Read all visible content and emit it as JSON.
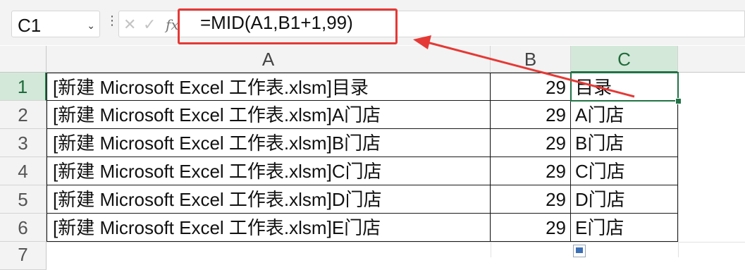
{
  "name_box": {
    "value": "C1"
  },
  "formula_bar": {
    "formula": "=MID(A1,B1+1,99)",
    "fx_label": "fx",
    "cancel_icon": "✕",
    "enter_icon": "✓"
  },
  "columns": [
    "A",
    "B",
    "C"
  ],
  "selected_cell": "C1",
  "rows": [
    {
      "num": "1",
      "a": "[新建 Microsoft Excel 工作表.xlsm]目录",
      "b": "29",
      "c": "目录"
    },
    {
      "num": "2",
      "a": "[新建 Microsoft Excel 工作表.xlsm]A门店",
      "b": "29",
      "c": "A门店"
    },
    {
      "num": "3",
      "a": "[新建 Microsoft Excel 工作表.xlsm]B门店",
      "b": "29",
      "c": "B门店"
    },
    {
      "num": "4",
      "a": "[新建 Microsoft Excel 工作表.xlsm]C门店",
      "b": "29",
      "c": "C门店"
    },
    {
      "num": "5",
      "a": "[新建 Microsoft Excel 工作表.xlsm]D门店",
      "b": "29",
      "c": "D门店"
    },
    {
      "num": "6",
      "a": "[新建 Microsoft Excel 工作表.xlsm]E门店",
      "b": "29",
      "c": "E门店"
    },
    {
      "num": "7",
      "a": "",
      "b": "",
      "c": ""
    }
  ],
  "colors": {
    "annotation": "#e53935",
    "selection": "#217346"
  }
}
